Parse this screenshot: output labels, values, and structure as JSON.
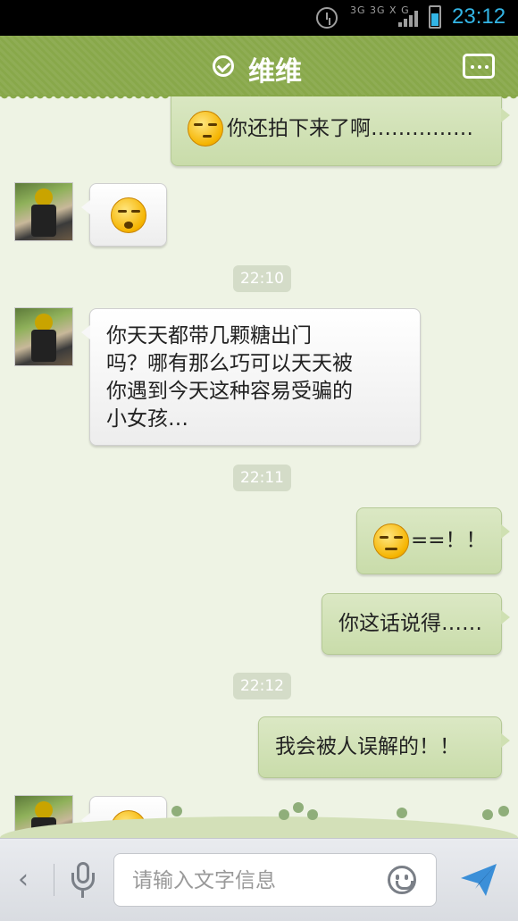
{
  "status_bar": {
    "network": "3G 3G X G",
    "time": "23:12"
  },
  "header": {
    "title": "维维"
  },
  "messages": [
    {
      "side": "right",
      "text": "你还拍下来了啊……………"
    },
    {
      "side": "left",
      "text": ""
    },
    {
      "timestamp": "22:10"
    },
    {
      "side": "left",
      "lines": [
        "你天天都带几颗糖出门",
        "吗？哪有那么巧可以天天被",
        "你遇到今天这种容易受骗的",
        "小女孩…"
      ]
    },
    {
      "timestamp": "22:11"
    },
    {
      "side": "right",
      "text": "==！！"
    },
    {
      "side": "right",
      "text": "你这话说得……"
    },
    {
      "timestamp": "22:12"
    },
    {
      "side": "right",
      "text": "我会被人误解的！！"
    },
    {
      "side": "left",
      "text": ""
    }
  ],
  "input": {
    "placeholder": "请输入文字信息",
    "value": ""
  },
  "colors": {
    "header": "#88a84a",
    "time": "#33b5e5",
    "bubble_right": "#cfe0b2",
    "bubble_left": "#f5f5f5",
    "chat_bg": "#eef3e4"
  }
}
